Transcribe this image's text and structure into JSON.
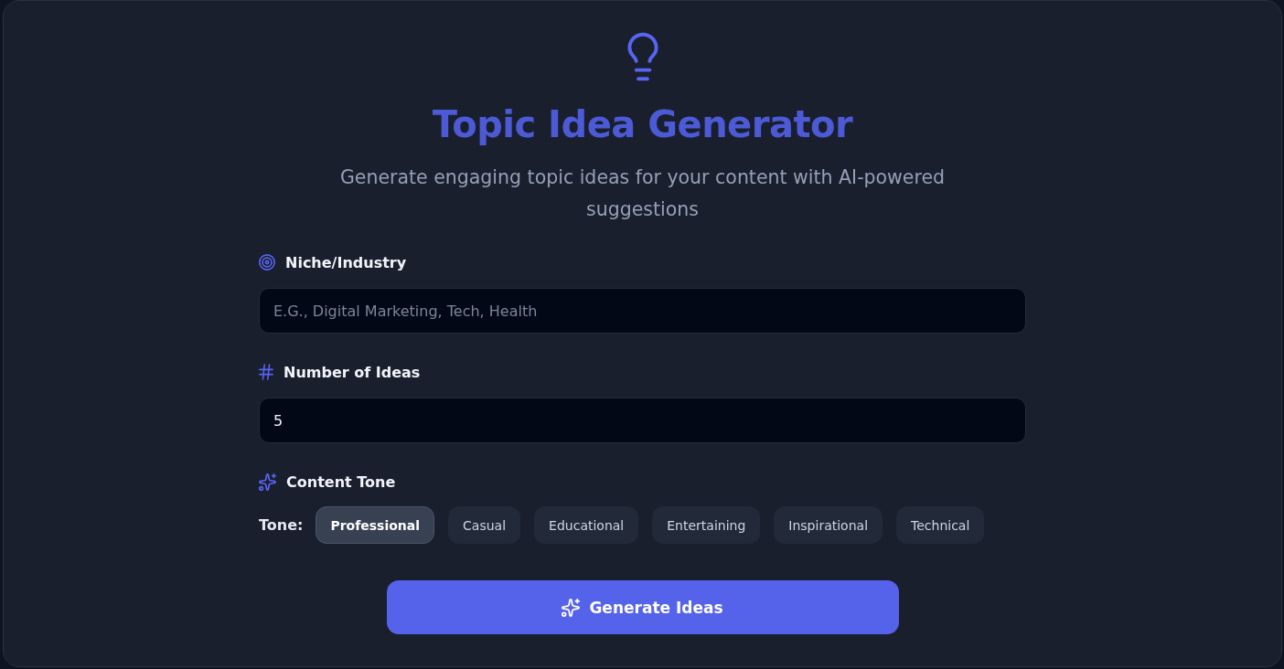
{
  "header": {
    "title": "Topic Idea Generator",
    "subtitle": "Generate engaging topic ideas for your content with AI-powered suggestions"
  },
  "fields": [
    {
      "kind": "text",
      "label": "Niche/Industry",
      "placeholder": "E.G., Digital Marketing, Tech, Health"
    },
    {
      "kind": "number",
      "label": "Number of Ideas",
      "value": "5"
    }
  ],
  "content_tone": {
    "label": "Content Tone",
    "tone_label": "Tone:",
    "options": [
      {
        "label": "Professional",
        "selected": true
      },
      {
        "label": "Casual",
        "selected": false
      },
      {
        "label": "Educational",
        "selected": false
      },
      {
        "label": "Entertaining",
        "selected": false
      },
      {
        "label": "Inspirational",
        "selected": false
      },
      {
        "label": "Technical",
        "selected": false
      }
    ]
  },
  "generate_button": {
    "label": "Generate Ideas"
  }
}
